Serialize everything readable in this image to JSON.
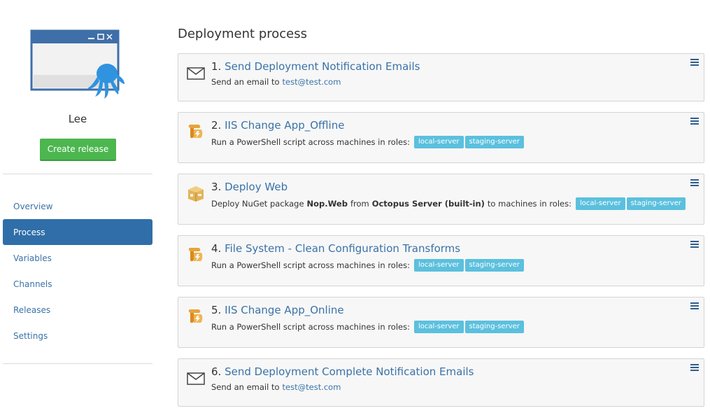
{
  "project": {
    "name": "Lee",
    "create_release_label": "Create release"
  },
  "nav": {
    "items": [
      {
        "label": "Overview"
      },
      {
        "label": "Process"
      },
      {
        "label": "Variables"
      },
      {
        "label": "Channels"
      },
      {
        "label": "Releases"
      },
      {
        "label": "Settings"
      }
    ],
    "active": "Process"
  },
  "main": {
    "title": "Deployment process",
    "steps": [
      {
        "number": "1.",
        "name": "Send Deployment Notification Emails",
        "icon": "envelope-icon",
        "desc_prefix": "Send an email to",
        "email": "test@test.com"
      },
      {
        "number": "2.",
        "name": "IIS Change App_Offline",
        "icon": "powershell-script-icon",
        "desc_prefix": "Run a PowerShell script across machines in roles:",
        "roles": [
          "local-server",
          "staging-server"
        ]
      },
      {
        "number": "3.",
        "name": "Deploy Web",
        "icon": "nuget-package-icon",
        "desc_prefix": "Deploy NuGet package",
        "package": "Nop.Web",
        "desc_from": "from",
        "feed": "Octopus Server (built-in)",
        "desc_suffix": "to machines in roles:",
        "roles": [
          "local-server",
          "staging-server"
        ]
      },
      {
        "number": "4.",
        "name": "File System - Clean Configuration Transforms",
        "icon": "powershell-script-icon",
        "desc_prefix": "Run a PowerShell script across machines in roles:",
        "roles": [
          "local-server",
          "staging-server"
        ]
      },
      {
        "number": "5.",
        "name": "IIS Change App_Online",
        "icon": "powershell-script-icon",
        "desc_prefix": "Run a PowerShell script across machines in roles:",
        "roles": [
          "local-server",
          "staging-server"
        ]
      },
      {
        "number": "6.",
        "name": "Send Deployment Complete Notification Emails",
        "icon": "envelope-icon",
        "desc_prefix": "Send an email to",
        "email": "test@test.com"
      }
    ]
  },
  "colors": {
    "link": "#3a72a8",
    "active_nav": "#2f6ea8",
    "create_button": "#4cb64f",
    "role_badge": "#5bc0de",
    "octopus": "#2f93e0"
  }
}
